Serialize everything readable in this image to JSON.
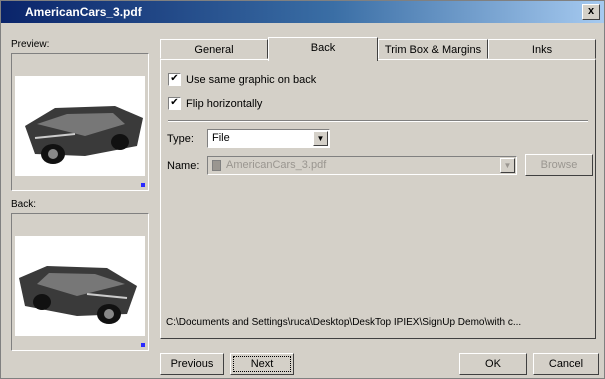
{
  "window": {
    "title": "AmericanCars_3.pdf",
    "close": "x"
  },
  "left": {
    "preview_label": "Preview:",
    "back_label": "Back:"
  },
  "tabs": [
    {
      "label": "General",
      "active": false
    },
    {
      "label": "Back",
      "active": true
    },
    {
      "label": "Trim Box & Margins",
      "active": false
    },
    {
      "label": "Inks",
      "active": false
    }
  ],
  "back": {
    "use_same_label": "Use same graphic on back",
    "use_same_checked": true,
    "flip_label": "Flip horizontally",
    "flip_checked": true,
    "type_label": "Type:",
    "type_value": "File",
    "name_label": "Name:",
    "name_value": "AmericanCars_3.pdf",
    "browse_label": "Browse",
    "path": "C:\\Documents and Settings\\ruca\\Desktop\\DeskTop IPIEX\\SignUp Demo\\with c..."
  },
  "footer": {
    "previous": "Previous",
    "next": "Next",
    "ok": "OK",
    "cancel": "Cancel"
  },
  "colors": {
    "title_start": "#0a246a",
    "title_end": "#a6caf0",
    "face": "#d4d0c8",
    "corner_dot": "#2a2aff"
  }
}
